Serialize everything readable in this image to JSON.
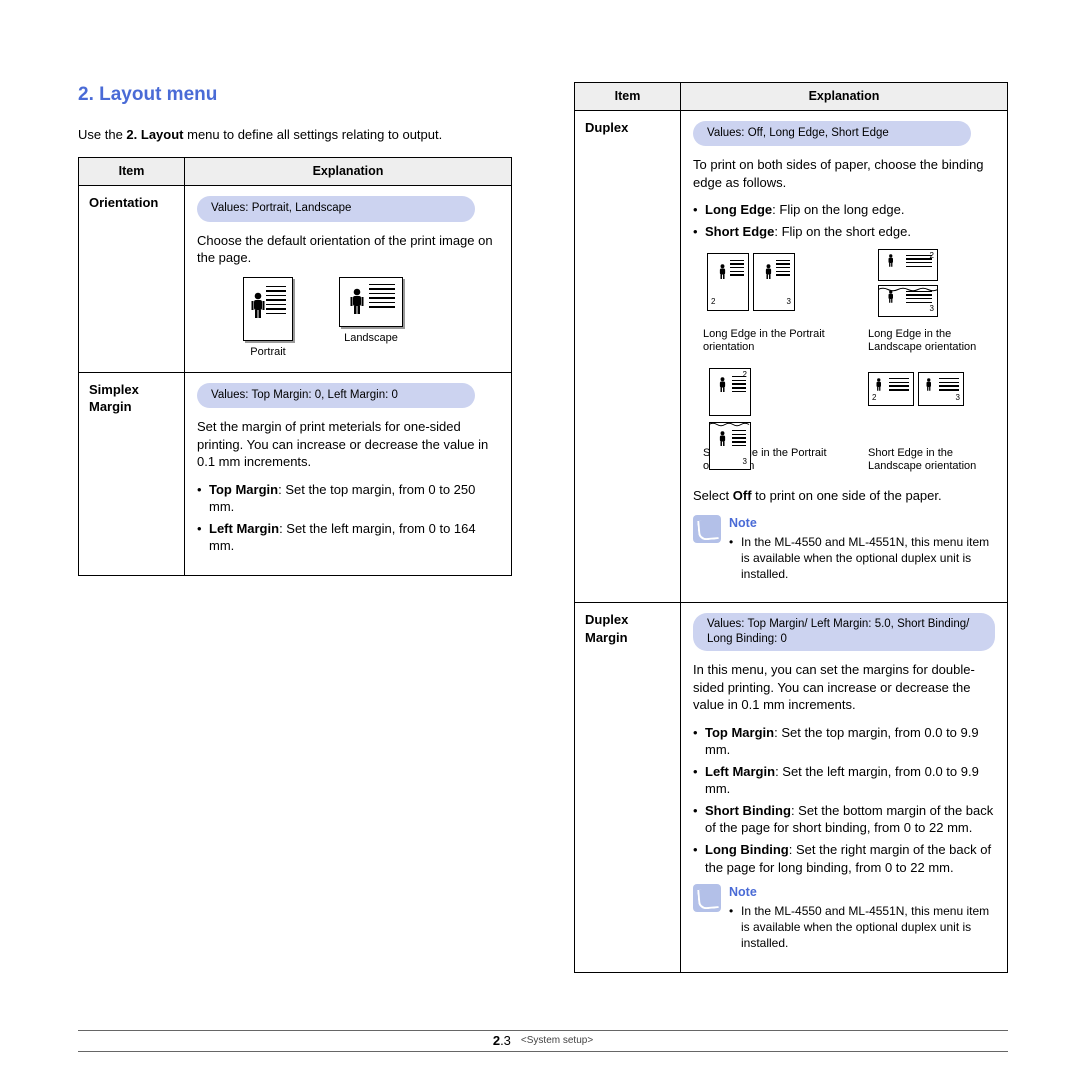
{
  "heading": "2. Layout menu",
  "intro_pre": "Use the ",
  "intro_bold": "2. Layout",
  "intro_post": " menu to define all settings relating to output.",
  "hdr_item": "Item",
  "hdr_expl": "Explanation",
  "left": {
    "orientation": {
      "item": "Orientation",
      "values": "Values: Portrait, Landscape",
      "desc": "Choose the default orientation of the print image on the page.",
      "portrait_lbl": "Portrait",
      "landscape_lbl": "Landscape"
    },
    "simplex": {
      "item": "Simplex Margin",
      "values": "Values: Top Margin: 0, Left Margin: 0",
      "desc": "Set the margin of print meterials for one-sided printing. You can increase or decrease the value in 0.1 mm increments.",
      "bul1_b": "Top Margin",
      "bul1_r": ": Set the top margin, from 0 to 250 mm.",
      "bul2_b": "Left Margin",
      "bul2_r": ": Set the left margin, from 0 to 164 mm."
    }
  },
  "right": {
    "duplex": {
      "item": "Duplex",
      "values": "Values: Off, Long Edge, Short Edge",
      "desc": "To print on both sides of paper, choose the binding edge as follows.",
      "b1_b": "Long Edge",
      "b1_r": ": Flip on the long edge.",
      "b2_b": "Short Edge",
      "b2_r": ": Flip on the short edge.",
      "fig1": "Long Edge in the Portrait orientation",
      "fig2": "Long Edge in the Landscape orientation",
      "fig3": "Short Edge in the Portrait orientation",
      "fig4": "Short Edge in the Landscape orientation",
      "sel_pre": "Select ",
      "sel_b": "Off",
      "sel_post": " to print on one side of the paper.",
      "note_title": "Note",
      "note_text": "In the ML-4550 and ML-4551N, this menu item is available when the optional duplex unit is installed."
    },
    "dmargin": {
      "item": "Duplex Margin",
      "values": "Values: Top Margin/ Left Margin: 5.0, Short Binding/ Long Binding: 0",
      "desc": "In this menu, you can set the margins for double-sided printing. You can increase or decrease the value in 0.1 mm increments.",
      "b1_b": "Top Margin",
      "b1_r": ": Set the top margin, from 0.0 to 9.9 mm.",
      "b2_b": "Left Margin",
      "b2_r": ": Set the left margin, from 0.0 to 9.9 mm.",
      "b3_b": "Short Binding",
      "b3_r": ": Set the bottom margin of the back of the page for short binding, from 0 to 22 mm.",
      "b4_b": "Long Binding",
      "b4_r": ": Set the right margin of the back of the page for long binding, from 0 to 22 mm.",
      "note_title": "Note",
      "note_text": "In the ML-4550 and ML-4551N, this menu item is available when the optional duplex unit is installed."
    }
  },
  "footer": {
    "pg_major": "2",
    "pg_minor": ".3",
    "section": "<System setup>"
  }
}
